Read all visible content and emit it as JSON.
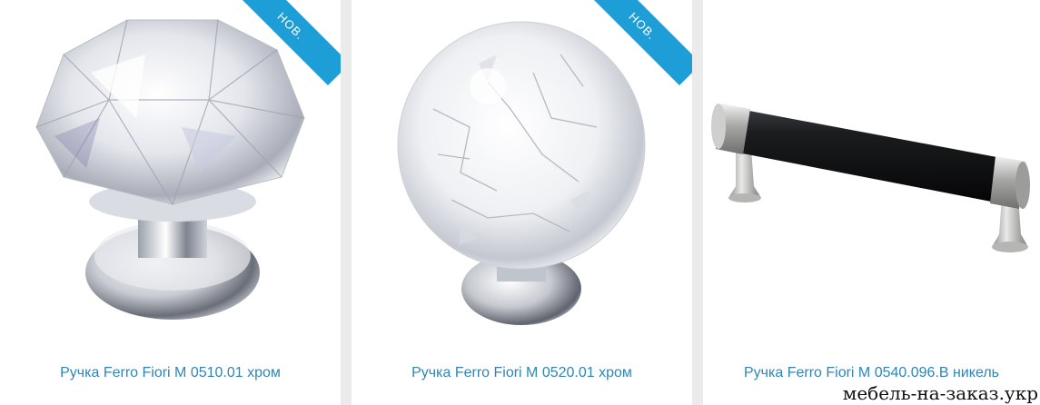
{
  "products": [
    {
      "title": "Ручка Ferro Fiori M 0510.01 хром",
      "badge": "НОВ.",
      "image": "crystal-faceted-knob"
    },
    {
      "title": "Ручка Ferro Fiori M 0520.01 хром",
      "badge": "НОВ.",
      "image": "crackle-glass-ball-knob"
    },
    {
      "title": "Ручка Ferro Fiori M 0540.096.B никель",
      "badge": "",
      "image": "black-bar-pull-handle"
    }
  ],
  "watermark": "мебель-на-заказ.укр",
  "colors": {
    "badge": "#1e9ed6",
    "title": "#2e86b8",
    "background": "#ebebeb"
  }
}
